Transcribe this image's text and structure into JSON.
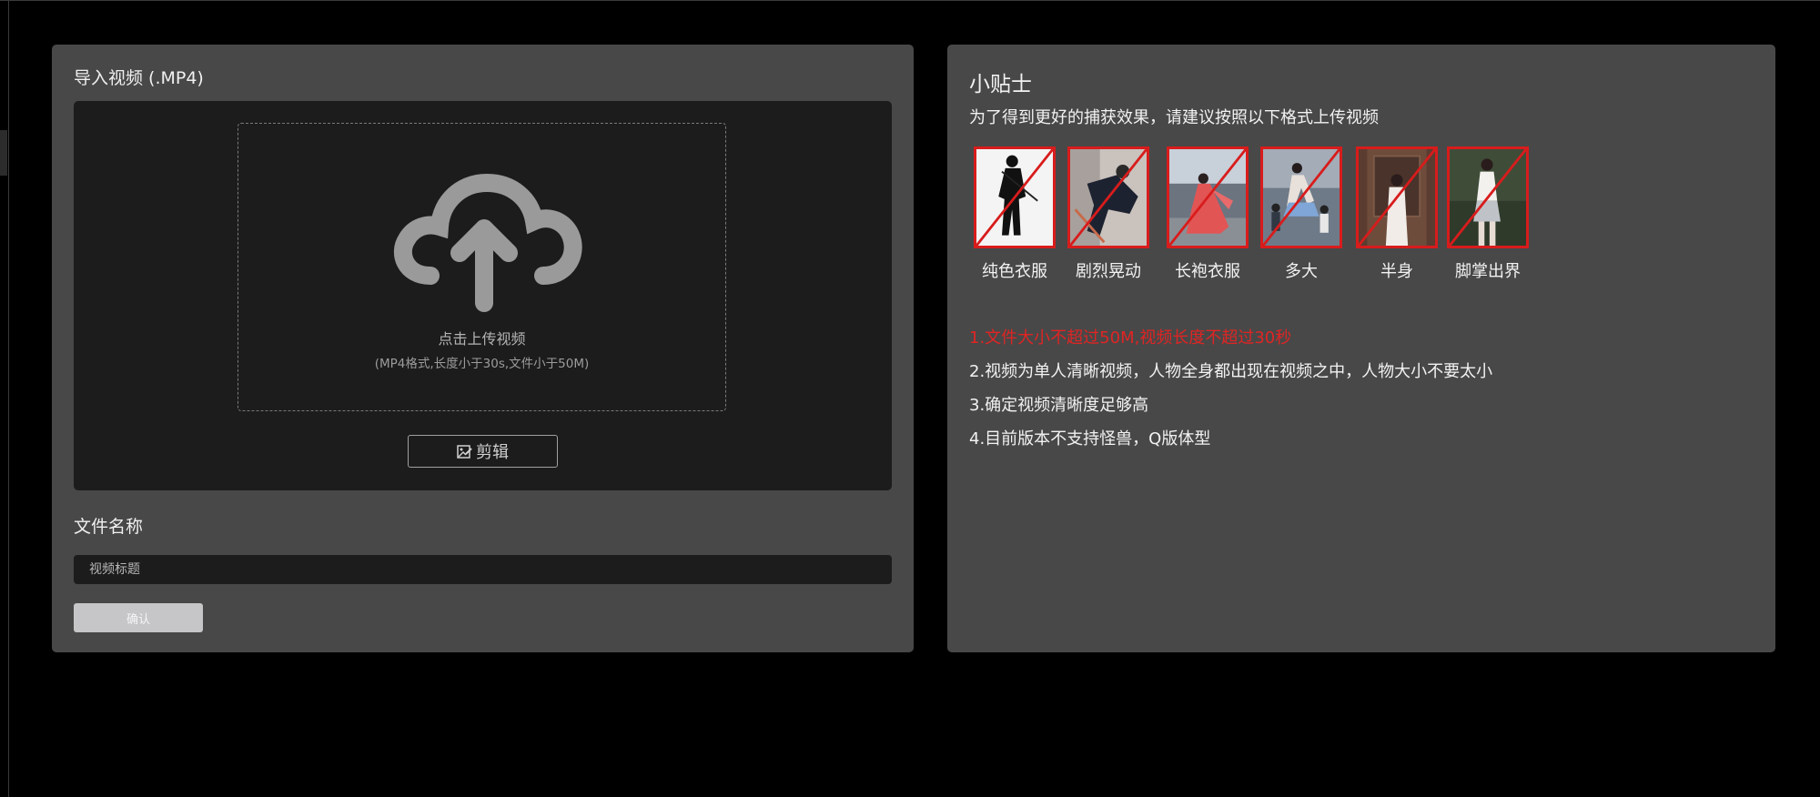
{
  "upload_panel": {
    "title": "导入视频 (.MP4)",
    "upload_text": "点击上传视频",
    "upload_hint": "(MP4格式,长度小于30s,文件小于50M)",
    "edit_button_label": "剪辑",
    "file_name_label": "文件名称",
    "title_input_placeholder": "视频标题",
    "title_input_value": "",
    "confirm_button_label": "确认"
  },
  "tips_panel": {
    "title": "小贴士",
    "subtitle": "为了得到更好的捕获效果，请建议按照以下格式上传视频",
    "examples": [
      {
        "label": "纯色衣服"
      },
      {
        "label": "剧烈晃动"
      },
      {
        "label": "长袍衣服"
      },
      {
        "label": "多大"
      },
      {
        "label": "半身"
      },
      {
        "label": "脚掌出界"
      }
    ],
    "rules": [
      {
        "text": "1.文件大小不超过50M,视频长度不超过30秒",
        "warning": true
      },
      {
        "text": "2.视频为单人清晰视频，人物全身都出现在视频之中，人物大小不要太小",
        "warning": false
      },
      {
        "text": "3.确定视频清晰度足够高",
        "warning": false
      },
      {
        "text": "4.目前版本不支持怪兽，Q版体型",
        "warning": false
      }
    ]
  },
  "colors": {
    "background": "#000000",
    "panel": "#484848",
    "inset": "#1c1c1c",
    "warning": "#e02424",
    "cross_out": "#d81c1c"
  }
}
